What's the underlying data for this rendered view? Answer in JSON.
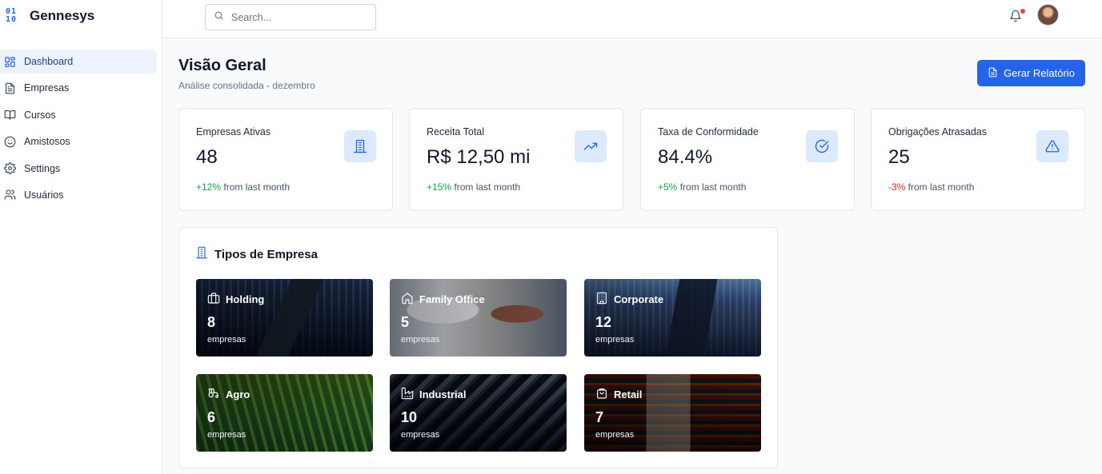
{
  "brand": {
    "logo_top": "01",
    "logo_bottom": "10",
    "name": "Gennesys"
  },
  "sidebar": {
    "items": [
      {
        "label": "Dashboard",
        "icon": "layout-dashboard-icon",
        "active": true
      },
      {
        "label": "Empresas",
        "icon": "file-text-icon"
      },
      {
        "label": "Cursos",
        "icon": "book-open-icon"
      },
      {
        "label": "Amistosos",
        "icon": "smile-icon"
      },
      {
        "label": "Settings",
        "icon": "gear-icon"
      },
      {
        "label": "Usuários",
        "icon": "users-icon"
      }
    ]
  },
  "header": {
    "search": {
      "placeholder": "Search...",
      "value": ""
    },
    "notifications": {
      "has_unread": true
    }
  },
  "main": {
    "title": "Visão Geral",
    "subtitle": "Análise consolidada - dezembro",
    "report_button": "Gerar Relatório",
    "stats": [
      {
        "label": "Empresas Ativas",
        "value": "48",
        "change": "+12%",
        "change_suffix": " from last month",
        "trend": "positive",
        "icon": "building-icon"
      },
      {
        "label": "Receita Total",
        "value": "R$ 12,50 mi",
        "change": "+15%",
        "change_suffix": " from last month",
        "trend": "positive",
        "icon": "trending-up-icon"
      },
      {
        "label": "Taxa de Conformidade",
        "value": "84.4%",
        "change": "+5%",
        "change_suffix": " from last month",
        "trend": "positive",
        "icon": "check-circle-icon"
      },
      {
        "label": "Obrigações Atrasadas",
        "value": "25",
        "change": "-3%",
        "change_suffix": " from last month",
        "trend": "negative",
        "icon": "alert-triangle-icon"
      }
    ],
    "company_types": {
      "title": "Tipos de Empresa",
      "unit": "empresas",
      "items": [
        {
          "name": "Holding",
          "count": "8",
          "icon": "briefcase-icon"
        },
        {
          "name": "Family Office",
          "count": "5",
          "icon": "home-icon"
        },
        {
          "name": "Corporate",
          "count": "12",
          "icon": "office-building-icon"
        },
        {
          "name": "Agro",
          "count": "6",
          "icon": "tractor-icon"
        },
        {
          "name": "Industrial",
          "count": "10",
          "icon": "factory-icon"
        },
        {
          "name": "Retail",
          "count": "7",
          "icon": "shopping-bag-icon"
        }
      ]
    }
  },
  "colors": {
    "accent": "#2563eb",
    "positive": "#16a34a",
    "negative": "#dc2626",
    "icon_bg": "#dbeafe"
  }
}
